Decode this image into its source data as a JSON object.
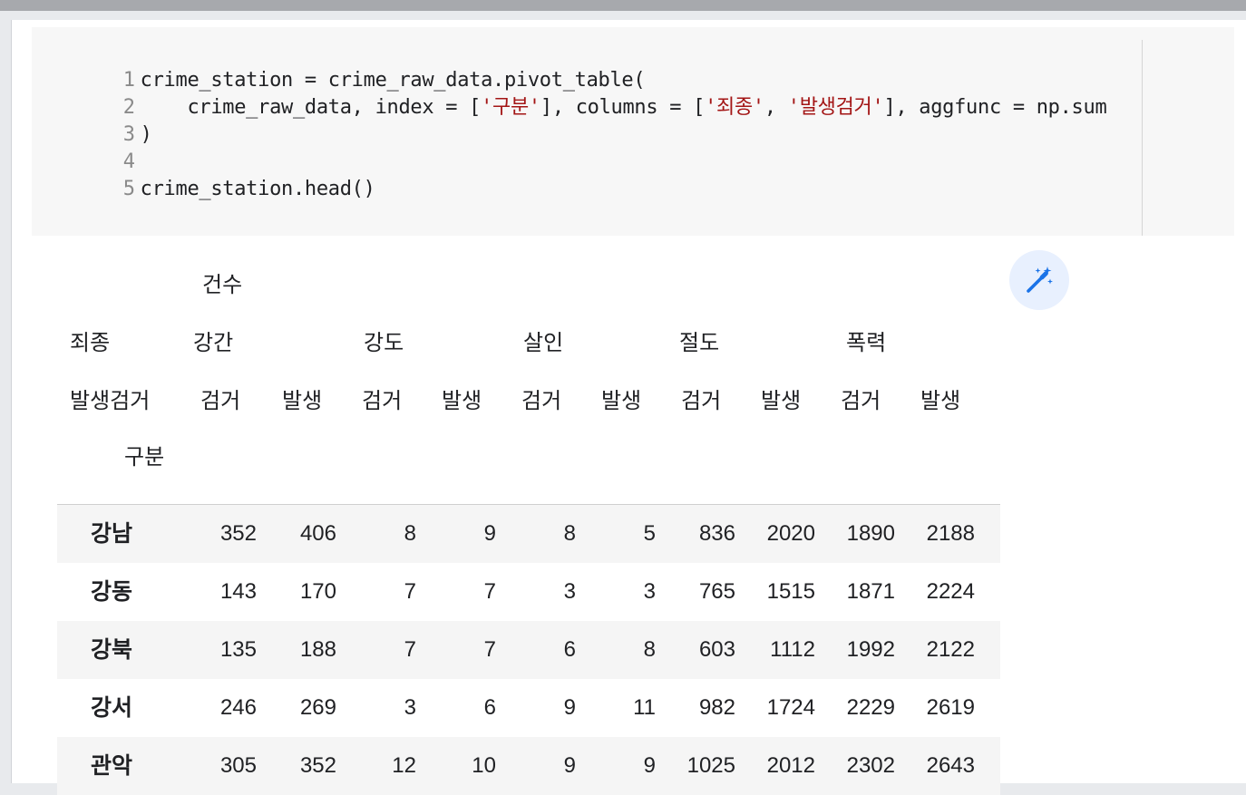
{
  "code": {
    "lines": [
      {
        "num": "1",
        "pre": "crime_station = crime_raw_data.pivot_table("
      },
      {
        "num": "2",
        "pre": "    crime_raw_data, index = [",
        "s1": "'구분'",
        "mid1": "], columns = [",
        "s2": "'죄종'",
        "mid2": ", ",
        "s3": "'발생검거'",
        "post": "], aggfunc = np.sum"
      },
      {
        "num": "3",
        "pre": ")"
      },
      {
        "num": "4",
        "pre": ""
      },
      {
        "num": "5",
        "pre": "crime_station.head()"
      }
    ]
  },
  "table": {
    "level0_label": "건수",
    "level1_name": "죄종",
    "level2_name": "발생검거",
    "index_name": "구분",
    "crime_types": [
      "강간",
      "강도",
      "살인",
      "절도",
      "폭력"
    ],
    "sub_headers": [
      "검거",
      "발생",
      "검거",
      "발생",
      "검거",
      "발생",
      "검거",
      "발생",
      "검거",
      "발생"
    ],
    "rows": [
      {
        "label": "강남",
        "values": [
          "352",
          "406",
          "8",
          "9",
          "8",
          "5",
          "836",
          "2020",
          "1890",
          "2188"
        ]
      },
      {
        "label": "강동",
        "values": [
          "143",
          "170",
          "7",
          "7",
          "3",
          "3",
          "765",
          "1515",
          "1871",
          "2224"
        ]
      },
      {
        "label": "강북",
        "values": [
          "135",
          "188",
          "7",
          "7",
          "6",
          "8",
          "603",
          "1112",
          "1992",
          "2122"
        ]
      },
      {
        "label": "강서",
        "values": [
          "246",
          "269",
          "3",
          "6",
          "9",
          "11",
          "982",
          "1724",
          "2229",
          "2619"
        ]
      },
      {
        "label": "관악",
        "values": [
          "305",
          "352",
          "12",
          "10",
          "9",
          "9",
          "1025",
          "2012",
          "2302",
          "2643"
        ]
      }
    ]
  },
  "icons": {
    "magic": "magic-wand-icon",
    "accent": "#1a73e8"
  }
}
